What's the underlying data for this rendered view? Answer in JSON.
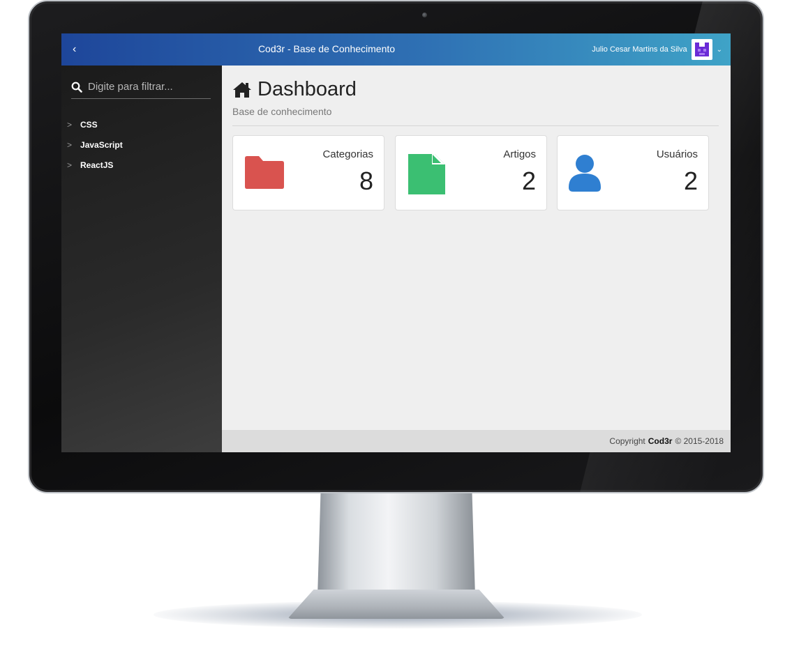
{
  "topbar": {
    "toggle_glyph": "‹",
    "title": "Cod3r - Base de Conhecimento",
    "user_name": "Julio Cesar Martins da Silva",
    "user_menu_glyph": "⌄"
  },
  "sidebar": {
    "filter_placeholder": "Digite para filtrar...",
    "items": [
      {
        "label": "CSS"
      },
      {
        "label": "JavaScript"
      },
      {
        "label": "ReactJS"
      }
    ]
  },
  "main": {
    "title": "Dashboard",
    "subtitle": "Base de conhecimento",
    "stats": [
      {
        "label": "Categorias",
        "value": "8",
        "icon": "folder-icon",
        "color": "#d9534f"
      },
      {
        "label": "Artigos",
        "value": "2",
        "icon": "file-icon",
        "color": "#3bbf72"
      },
      {
        "label": "Usuários",
        "value": "2",
        "icon": "user-icon",
        "color": "#2f7fd1"
      }
    ]
  },
  "footer": {
    "prefix": "Copyright",
    "brand": "Cod3r",
    "suffix": "© 2015-2018"
  },
  "colors": {
    "header_gradient_start": "#1e469a",
    "header_gradient_end": "#3fa3c7",
    "sidebar_bg": "#2a2a2a",
    "content_bg": "#efefef"
  }
}
